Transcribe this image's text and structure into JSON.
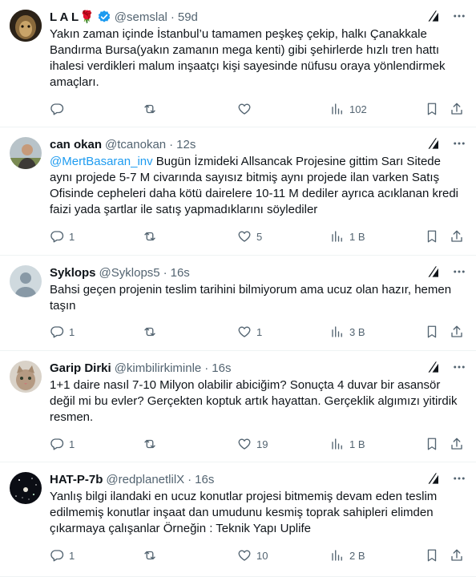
{
  "tweets": [
    {
      "name": "L A L",
      "flower": "🌹",
      "verified": true,
      "handle": "@semslal",
      "dot": "·",
      "time": "59d",
      "mention": "",
      "text": "Yakın zaman içinde İstanbul’u tamamen peşkeş çekip, halkı Çanakkale Bandırma Bursa(yakın zamanın mega kenti) gibi şehirlerde hızlı tren hattı ihalesi verdikleri malum inşaatçı kişi sayesinde nüfusu oraya yönlendirmek amaçları.",
      "replies": "",
      "retweets": "",
      "likes": "",
      "views": "102"
    },
    {
      "name": "can okan",
      "handle": "@tcanokan",
      "dot": "·",
      "time": "12s",
      "mention": "@MertBasaran_inv",
      "text": " Bugün İzmideki Allsancak Projesine gittim Sarı Sitede aynı projede 5-7 M civarında sayısız bitmiş aynı projede ilan varken Satış Ofisinde cepheleri daha kötü dairelere 10-11 M dediler ayrıca acıklanan kredi faizi yada şartlar ile satış yapmadıklarını söylediler",
      "replies": "1",
      "retweets": "",
      "likes": "5",
      "views": "1 B"
    },
    {
      "name": "Syklops",
      "handle": "@Syklops5",
      "dot": "·",
      "time": "16s",
      "mention": "",
      "text": "Bahsi geçen projenin teslim tarihini bilmiyorum ama ucuz olan hazır, hemen taşın",
      "replies": "1",
      "retweets": "",
      "likes": "1",
      "views": "3 B"
    },
    {
      "name": "Garip Dirki",
      "handle": "@kimbilirkiminle",
      "dot": "·",
      "time": "16s",
      "mention": "",
      "text": "1+1 daire nasıl 7-10 Milyon olabilir abiciğim? Sonuçta 4 duvar bir asansör değil mi bu evler? Gerçekten koptuk artık hayattan. Gerçeklik algımızı yitirdik resmen.",
      "replies": "1",
      "retweets": "",
      "likes": "19",
      "views": "1 B"
    },
    {
      "name": "HAT-P-7b",
      "handle": "@redplanetlilX",
      "dot": "·",
      "time": "16s",
      "mention": "",
      "text": "Yanlış bilgi ilandaki en ucuz konutlar projesi bitmemiş devam eden teslim edilmemiş konutlar inşaat dan umudunu kesmiş toprak sahipleri elimden çıkarmaya çalışanlar Örneğin : Teknik Yapı Uplife",
      "replies": "1",
      "retweets": "",
      "likes": "10",
      "views": "2 B"
    }
  ],
  "colors": {
    "text": "#0f1419",
    "secondary": "#536471",
    "link": "#1d9bf0",
    "divider": "#eff3f4",
    "verified": "#1d9bf0"
  },
  "icons": [
    "reply-icon",
    "retweet-icon",
    "like-icon",
    "views-icon",
    "bookmark-icon",
    "share-icon",
    "grok-icon",
    "more-icon",
    "verified-icon"
  ]
}
